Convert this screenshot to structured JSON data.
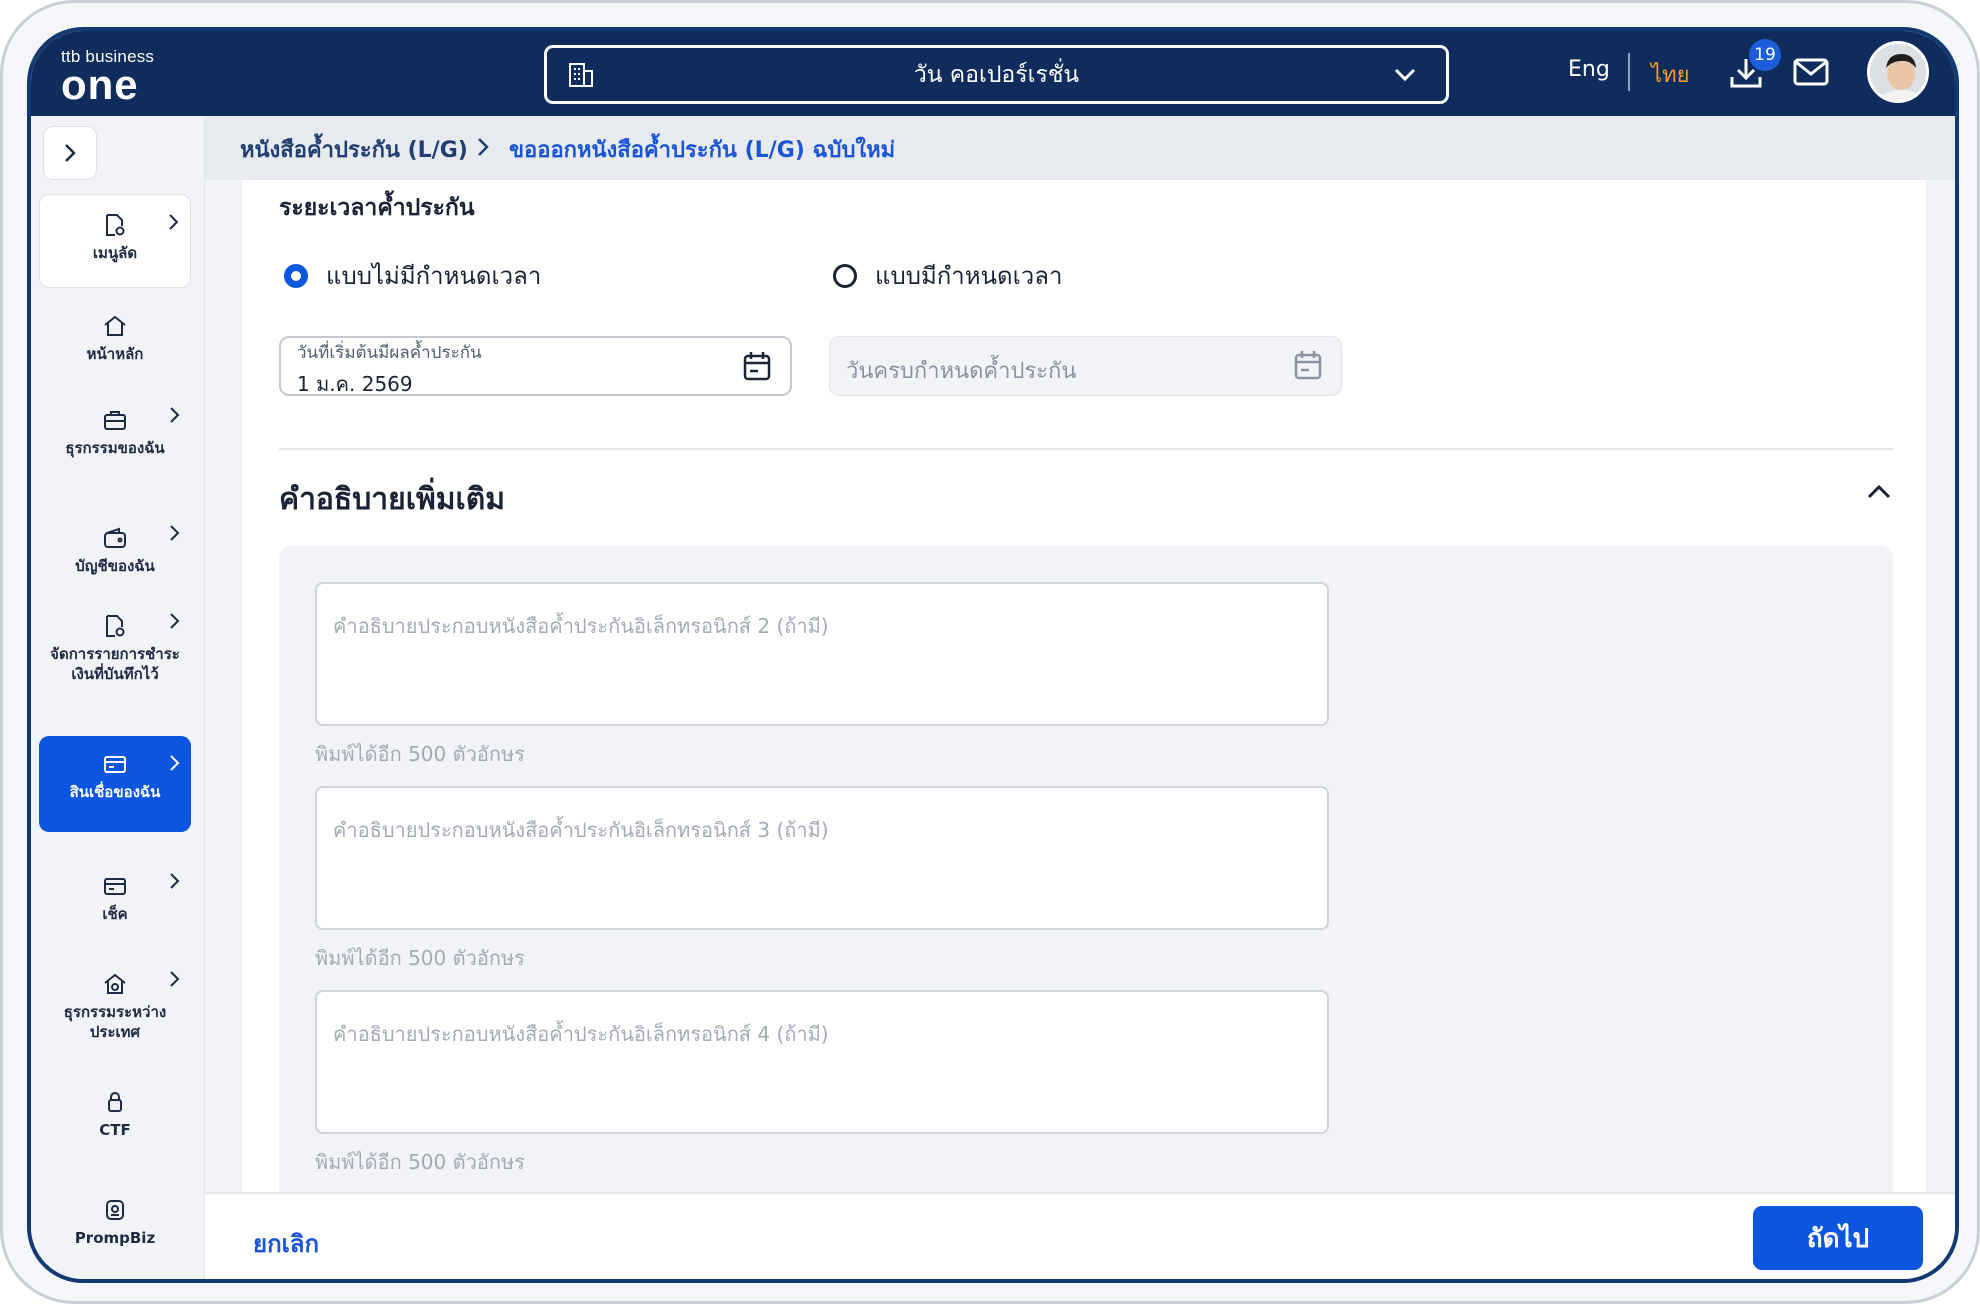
{
  "header": {
    "logo_small": "ttb business",
    "logo_big": "one",
    "company": "วัน คอเปอร์เรชั่น",
    "lang_en": "Eng",
    "lang_th": "ไทย",
    "download_badge": "19",
    "active_lang_color": "#f39b28"
  },
  "breadcrumb": {
    "parent": "หนังสือค้ำประกัน (L/G)",
    "current": "ขอออกหนังสือค้ำประกัน (L/G) ฉบับใหม่"
  },
  "sidebar": {
    "items": [
      {
        "label": "เมนูลัด",
        "icon": "document-gear-icon"
      },
      {
        "label": "หน้าหลัก",
        "icon": "home-icon"
      },
      {
        "label": "ธุรกรรมของฉัน",
        "icon": "briefcase-icon"
      },
      {
        "label": "บัญชีของฉัน",
        "icon": "wallet-icon"
      },
      {
        "label": "จัดการรายการชำระเงินที่บันทึกไว้",
        "icon": "document-gear-icon"
      },
      {
        "label": "สินเชื่อของฉัน",
        "icon": "card-icon"
      },
      {
        "label": "เช็ค",
        "icon": "card-icon"
      },
      {
        "label": "ธุรกรรมระหว่างประเทศ",
        "icon": "globe-home-icon"
      },
      {
        "label": "CTF",
        "icon": "lock-icon"
      },
      {
        "label": "PrompBiz",
        "icon": "promptbiz-icon"
      }
    ]
  },
  "guarantee_period": {
    "title": "ระยะเวลาค้ำประกัน",
    "option_unlimited": "แบบไม่มีกำหนดเวลา",
    "option_limited": "แบบมีกำหนดเวลา",
    "selected": "unlimited",
    "start_label": "วันที่เริ่มต้นมีผลค้ำประกัน",
    "start_value": "1 ม.ค. 2569",
    "end_placeholder": "วันครบกำหนดค้ำประกัน"
  },
  "extra_description": {
    "title": "คำอธิบายเพิ่มเติม",
    "fields": [
      {
        "placeholder": "คำอธิบายประกอบหนังสือค้ำประกันอิเล็กทรอนิกส์ 2 (ถ้ามี)",
        "hint": "พิมพ์ได้อีก 500 ตัวอักษร"
      },
      {
        "placeholder": "คำอธิบายประกอบหนังสือค้ำประกันอิเล็กทรอนิกส์ 3 (ถ้ามี)",
        "hint": "พิมพ์ได้อีก 500 ตัวอักษร"
      },
      {
        "placeholder": "คำอธิบายประกอบหนังสือค้ำประกันอิเล็กทรอนิกส์ 4 (ถ้ามี)",
        "hint": "พิมพ์ได้อีก 500 ตัวอักษร"
      }
    ]
  },
  "footer": {
    "cancel": "ยกเลิก",
    "next": "ถัดไป"
  }
}
